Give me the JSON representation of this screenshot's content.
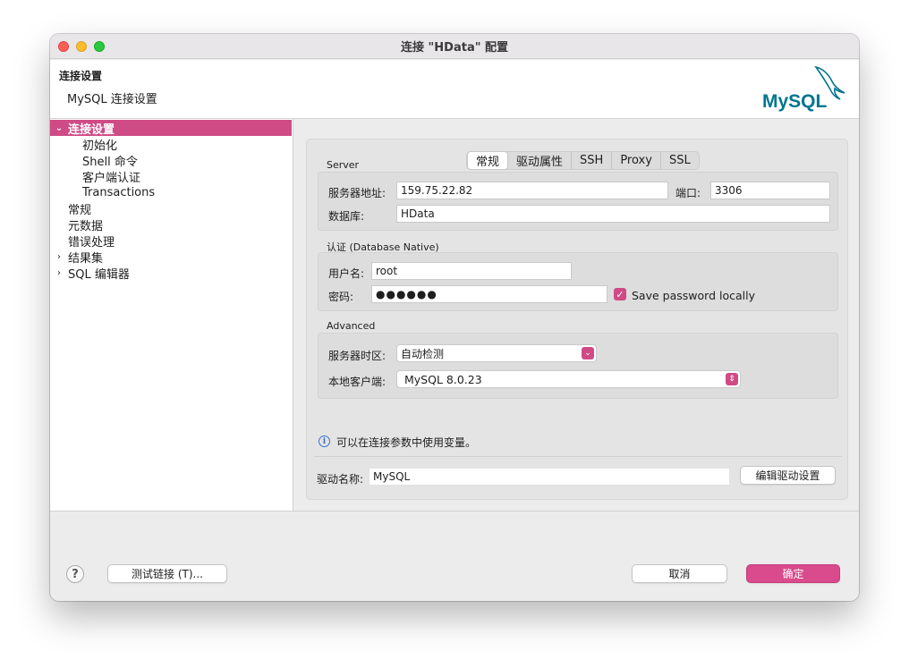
{
  "window": {
    "title": "连接 \"HData\" 配置"
  },
  "header": {
    "title": "连接设置",
    "subtitle": "MySQL 连接设置",
    "logo_text": "MySQL"
  },
  "sidebar": {
    "items": [
      {
        "label": "连接设置",
        "arrow": "⌄",
        "selected": true
      },
      {
        "label": "初始化"
      },
      {
        "label": "Shell 命令"
      },
      {
        "label": "客户端认证"
      },
      {
        "label": "Transactions"
      },
      {
        "label": "常规"
      },
      {
        "label": "元数据"
      },
      {
        "label": "错误处理"
      },
      {
        "label": "结果集",
        "arrow": "›"
      },
      {
        "label": "SQL 编辑器",
        "arrow": "›"
      }
    ]
  },
  "tabs": [
    "常规",
    "驱动属性",
    "SSH",
    "Proxy",
    "SSL"
  ],
  "server": {
    "section_label": "Server",
    "host_label": "服务器地址:",
    "host_value": "159.75.22.82",
    "port_label": "端口:",
    "port_value": "3306",
    "db_label": "数据库:",
    "db_value": "HData"
  },
  "auth": {
    "section_label": "认证 (Database Native)",
    "user_label": "用户名:",
    "user_value": "root",
    "password_label": "密码:",
    "password_value": "●●●●●●",
    "save_password_label": "Save password locally",
    "save_password_checked": "✓"
  },
  "advanced": {
    "section_label": "Advanced",
    "timezone_label": "服务器时区:",
    "timezone_value": "自动检测",
    "timezone_btn": "⌄",
    "client_label": "本地客户端:",
    "client_value": "MySQL 8.0.23",
    "client_btn": "⇕"
  },
  "info": {
    "icon": "i",
    "text": "可以在连接参数中使用变量。"
  },
  "driver": {
    "label": "驱动名称:",
    "value": "MySQL",
    "settings_button": "编辑驱动设置"
  },
  "footer": {
    "help": "?",
    "test_button": "测试链接 (T)...",
    "cancel_button": "取消",
    "ok_button": "确定"
  },
  "colors": {
    "accent": "#cf4b86",
    "mysql_blue": "#00758f",
    "mysql_orange": "#f29111"
  }
}
